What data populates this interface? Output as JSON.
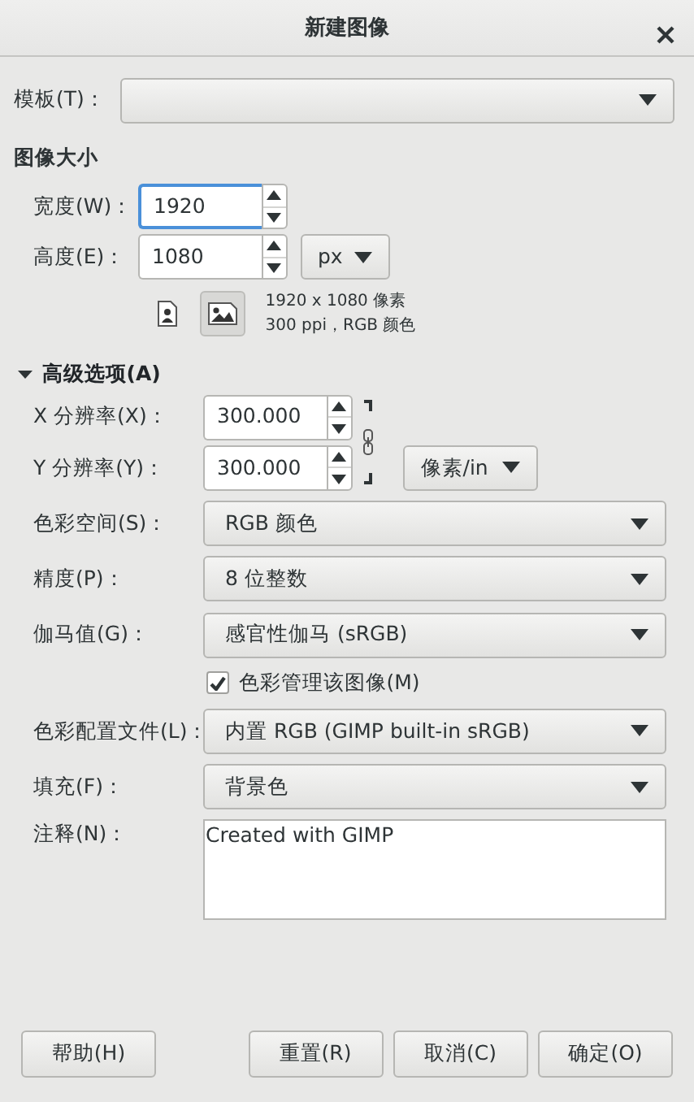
{
  "window": {
    "title": "新建图像"
  },
  "template": {
    "label": "模板(T)："
  },
  "image_size": {
    "heading": "图像大小",
    "width": {
      "label": "宽度(W)：",
      "value": "1920",
      "focused": true
    },
    "height": {
      "label": "高度(E)：",
      "value": "1080",
      "focused": false
    },
    "unit": "px",
    "orientations": [
      {
        "kind": "portrait",
        "selected": false
      },
      {
        "kind": "landscape",
        "selected": true
      }
    ],
    "info": [
      "1920 x 1080 像素",
      "300 ppi，RGB 颜色"
    ]
  },
  "advanced": {
    "label": "高级选项(A)",
    "expanded": true,
    "x_res": {
      "label": "X 分辨率(X)：",
      "value": "300.000"
    },
    "y_res": {
      "label": "Y 分辨率(Y)：",
      "value": "300.000"
    },
    "linked": true,
    "res_unit": "像素/in",
    "dropdowns": [
      {
        "label": "色彩空间(S)：",
        "value": "RGB 颜色"
      },
      {
        "label": "精度(P)：",
        "value": "8 位整数"
      },
      {
        "label": "伽马值(G)：",
        "value": "感官性伽马 (sRGB)"
      }
    ],
    "color_manage": {
      "label": "色彩管理该图像(M)",
      "checked": true
    },
    "dropdowns_2": [
      {
        "label": "色彩配置文件(L)：",
        "value": "内置 RGB (GIMP built-in sRGB)"
      },
      {
        "label": "填充(F)：",
        "value": "背景色"
      }
    ],
    "comment": {
      "label": "注释(N)：",
      "value": "Created with GIMP"
    }
  },
  "buttons": [
    "帮助(H)",
    "重置(R)",
    "取消(C)",
    "确定(O)"
  ]
}
